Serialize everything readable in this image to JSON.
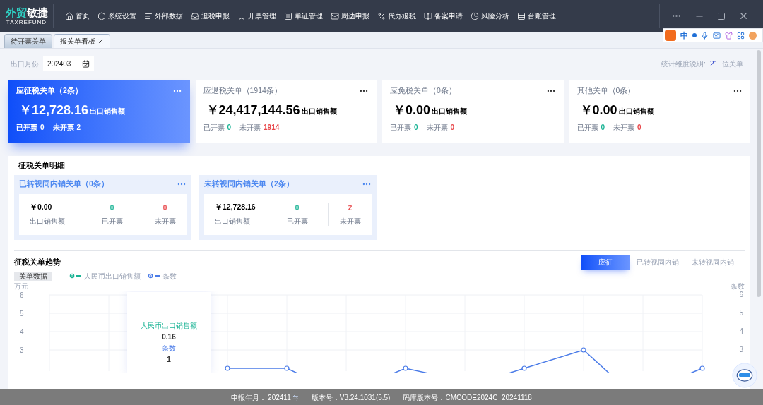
{
  "logo": {
    "accent": "外贸",
    "rest": "敏捷",
    "subtitle": "TAXREFUND"
  },
  "nav": [
    {
      "label": "首页"
    },
    {
      "label": "系统设置"
    },
    {
      "label": "外部数据"
    },
    {
      "label": "退税申报"
    },
    {
      "label": "开票管理"
    },
    {
      "label": "单证管理"
    },
    {
      "label": "周边申报"
    },
    {
      "label": "代办退税"
    },
    {
      "label": "备案申请"
    },
    {
      "label": "风险分析"
    },
    {
      "label": "台账管理"
    }
  ],
  "ime_toolbar": {
    "mode": "中"
  },
  "tabs": [
    {
      "label": "待开票关单",
      "selected": false,
      "closable": false
    },
    {
      "label": "报关单看板",
      "selected": true,
      "closable": true
    }
  ],
  "filter": {
    "label": "出口月份",
    "value": "202403",
    "note_label": "统计维度说明:",
    "note_count": "21",
    "note_unit": "位关单"
  },
  "summary_cards": [
    {
      "title": "应征税关单（2条）",
      "amount": "￥12,728.16",
      "amount_unit": "出口销售额",
      "issued_label": "已开票",
      "issued": "0",
      "unissued_label": "未开票",
      "unissued": "2",
      "selected": true
    },
    {
      "title": "应退税关单（1914条）",
      "amount": "￥24,417,144.56",
      "amount_unit": "出口销售额",
      "issued_label": "已开票",
      "issued": "0",
      "unissued_label": "未开票",
      "unissued": "1914",
      "selected": false
    },
    {
      "title": "应免税关单（0条）",
      "amount": "￥0.00",
      "amount_unit": "出口销售额",
      "issued_label": "已开票",
      "issued": "0",
      "unissued_label": "未开票",
      "unissued": "0",
      "selected": false
    },
    {
      "title": "其他关单（0条）",
      "amount": "￥0.00",
      "amount_unit": "出口销售额",
      "issued_label": "已开票",
      "issued": "0",
      "unissued_label": "未开票",
      "unissued": "0",
      "selected": false
    }
  ],
  "detail": {
    "title": "征税关单明细",
    "cards": [
      {
        "title": "已转视同内销关单（0条）",
        "amount": "￥0.00",
        "amount_label": "出口销售额",
        "issued": "0",
        "issued_label": "已开票",
        "unissued": "0",
        "unissued_label": "未开票"
      },
      {
        "title": "未转视同内销关单（2条）",
        "amount": "￥12,728.16",
        "amount_label": "出口销售额",
        "issued": "0",
        "issued_label": "已开票",
        "unissued": "2",
        "unissued_label": "未开票"
      }
    ]
  },
  "trend": {
    "title": "征税关单趋势",
    "data_tag": "关单数据",
    "tabs": [
      {
        "label": "应征",
        "selected": true
      },
      {
        "label": "已转视同内销",
        "selected": false
      },
      {
        "label": "未转视同内销",
        "selected": false
      }
    ],
    "right_axis_label": "条数",
    "right_yticks": [
      "6",
      "5",
      "4",
      "3"
    ],
    "tooltip": {
      "label1": "人民币出口销售额",
      "value1": "0.16",
      "label2": "条数",
      "value2": "1"
    },
    "chart": {
      "ylabel": "万元",
      "yticks": [
        "6",
        "5",
        "4",
        "3"
      ],
      "legend": [
        {
          "name": "人民币出口销售额",
          "color": "#19b394"
        },
        {
          "name": "条数",
          "color": "#4a7be8"
        }
      ]
    }
  },
  "status_bar": {
    "period_label": "申报年月：",
    "period": "202411",
    "version": "版本号：V3.24.1031(5.5)",
    "code_version": "码库版本号：CMCODE2024C_20241118"
  }
}
